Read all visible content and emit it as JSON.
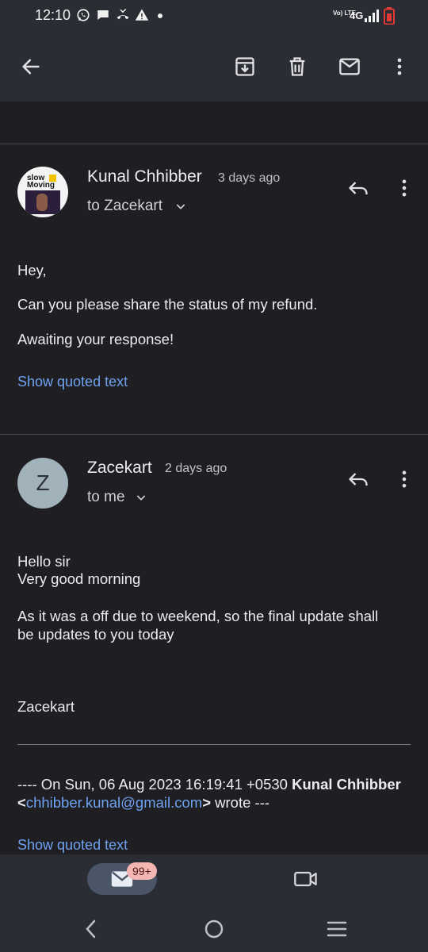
{
  "status_bar": {
    "time": "12:10",
    "left_icons": [
      "whatsapp-icon",
      "chat-bubble-icon",
      "missed-call-icon",
      "warning-icon",
      "dot-icon"
    ],
    "network_label": "4G",
    "volte_label": "Vo) LTE",
    "battery_color": "#e53935"
  },
  "toolbar": {
    "icons": [
      "back-arrow-icon",
      "archive-icon",
      "delete-icon",
      "mark-unread-icon",
      "more-vert-icon"
    ]
  },
  "messages": [
    {
      "sender": "Kunal Chhibber",
      "time_ago": "3 days ago",
      "to_line": "to Zacekart",
      "avatar_text": [
        "slow",
        "Moving"
      ],
      "body": [
        "Hey,",
        "Can you please share the status of my refund.",
        "Awaiting your response!"
      ],
      "show_quoted": "Show quoted text"
    },
    {
      "sender": "Zacekart",
      "time_ago": "2 days ago",
      "to_line": "to me",
      "avatar_letter": "Z",
      "avatar_color": "#a2b2ba",
      "body_lines": [
        "Hello sir",
        "Very good morning",
        "As it was a off due to weekend, so the final update shall",
        "be updates to you today",
        "Zacekart"
      ],
      "quote_header": {
        "prefix": "---- On Sun, 06 Aug 2023 16:19:41 +0530 ",
        "name": "Kunal Chhibber",
        "lt": "<",
        "email": "chhibber.kunal@gmail.com",
        "gt": ">",
        "suffix": " wrote ---"
      },
      "show_quoted": "Show quoted text"
    }
  ],
  "bottom_nav": {
    "mail_badge": "99+",
    "icons": [
      "mail-icon",
      "video-call-icon"
    ]
  },
  "system_nav": {
    "icons": [
      "back-icon",
      "home-icon",
      "recents-icon"
    ]
  },
  "colors": {
    "background": "#1f1f23",
    "bar": "#2a2d33",
    "link": "#6ea2f0",
    "pill": "#4b5568",
    "badge": "#f4b6b2"
  }
}
